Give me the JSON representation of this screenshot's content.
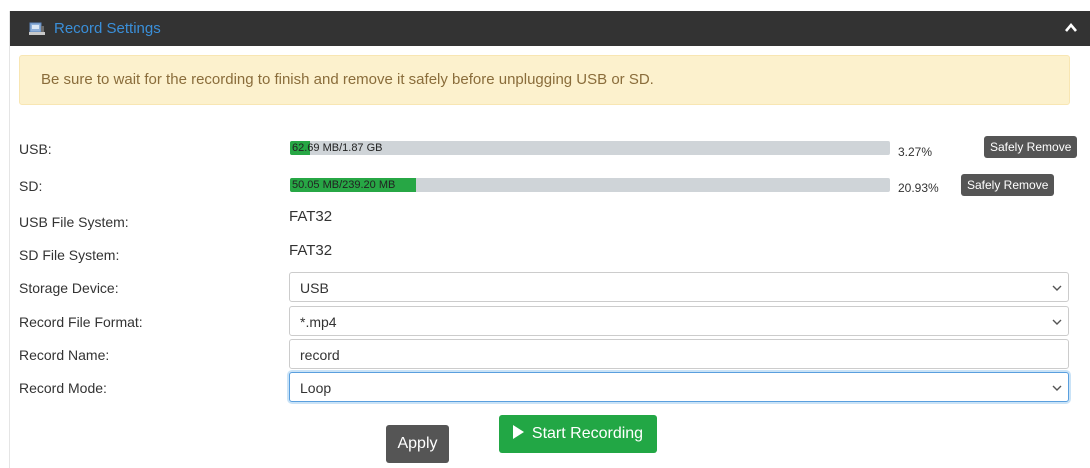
{
  "header": {
    "title": "Record Settings",
    "icon": "storage-icon",
    "collapse_icon": "chevron-up-icon"
  },
  "alert": {
    "text": "Be sure to wait for the recording to finish and remove it safely before unplugging USB or SD."
  },
  "usb": {
    "label": "USB:",
    "used_text": "62.69 MB/1.87 GB",
    "percent_text": "3.27%",
    "percent": 3.27,
    "remove_label": "Safely Remove"
  },
  "sd": {
    "label": "SD:",
    "used_text": "50.05 MB/239.20 MB",
    "percent_text": "20.93%",
    "percent": 20.93,
    "remove_label": "Safely Remove"
  },
  "usb_fs": {
    "label": "USB File System:",
    "value": "FAT32"
  },
  "sd_fs": {
    "label": "SD File System:",
    "value": "FAT32"
  },
  "storage_device": {
    "label": "Storage Device:",
    "value": "USB"
  },
  "file_format": {
    "label": "Record File Format:",
    "value": "*.mp4"
  },
  "record_name": {
    "label": "Record Name:",
    "value": "record"
  },
  "record_mode": {
    "label": "Record Mode:",
    "value": "Loop"
  },
  "actions": {
    "apply_label": "Apply",
    "start_label": "Start Recording"
  },
  "colors": {
    "header_bg": "#333333",
    "title": "#3a8fd9",
    "progress_fill": "#27a745",
    "start_button": "#22a745",
    "alert_bg": "#fcf1cd"
  }
}
